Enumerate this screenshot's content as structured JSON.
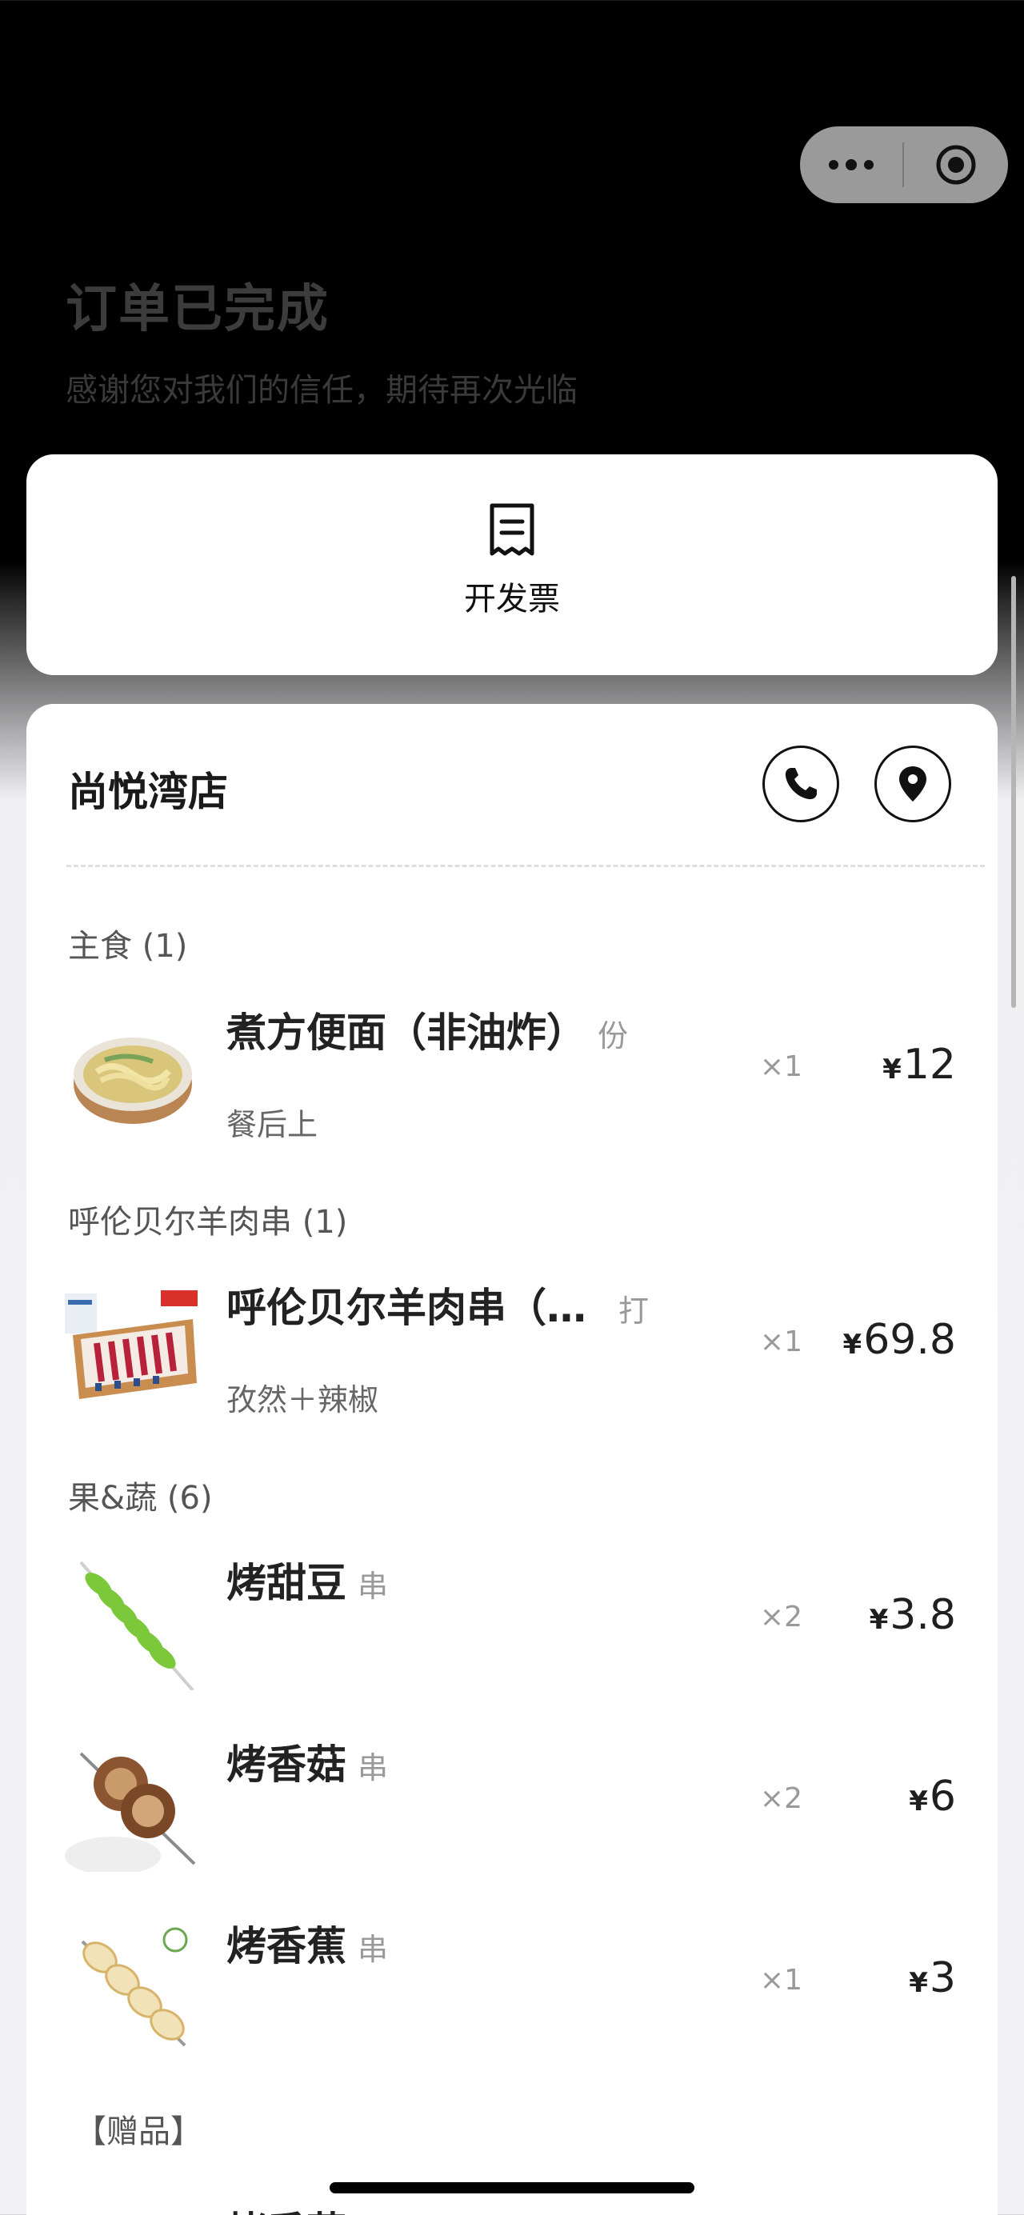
{
  "header": {
    "status_title": "订单已完成",
    "status_subtitle": "感谢您对我们的信任，期待再次光临",
    "capsule": {
      "more_icon": "more-dots-icon",
      "close_icon": "target-circle-icon"
    }
  },
  "invoice": {
    "label": "开发票",
    "icon": "receipt-icon"
  },
  "store": {
    "name": "尚悦湾店",
    "phone_icon": "phone-icon",
    "location_icon": "location-pin-icon"
  },
  "categories": [
    {
      "label": "主食 (1)",
      "items": [
        {
          "name": "煮方便面（非油炸）",
          "unit": "份",
          "note": "餐后上",
          "qty": "×1",
          "currency": "¥",
          "price": "12",
          "thumb": "noodle-bowl"
        }
      ]
    },
    {
      "label": "呼伦贝尔羊肉串 (1)",
      "items": [
        {
          "name": "呼伦贝尔羊肉串（…",
          "unit": "打",
          "note": "孜然＋辣椒",
          "qty": "×1",
          "currency": "¥",
          "price": "69.8",
          "thumb": "lamb-skewer-box"
        }
      ]
    },
    {
      "label": "果&蔬 (6)",
      "items": [
        {
          "name": "烤甜豆",
          "unit": "串",
          "note": "",
          "qty": "×2",
          "currency": "¥",
          "price": "3.8",
          "thumb": "sweet-pea-skewer"
        },
        {
          "name": "烤香菇",
          "unit": "串",
          "note": "",
          "qty": "×2",
          "currency": "¥",
          "price": "6",
          "thumb": "mushroom-skewer"
        },
        {
          "name": "烤香蕉",
          "unit": "串",
          "note": "",
          "qty": "×1",
          "currency": "¥",
          "price": "3",
          "thumb": "banana-skewer"
        }
      ]
    }
  ],
  "gift": {
    "label": "【赠品】",
    "partial_item": "烤香菇"
  }
}
